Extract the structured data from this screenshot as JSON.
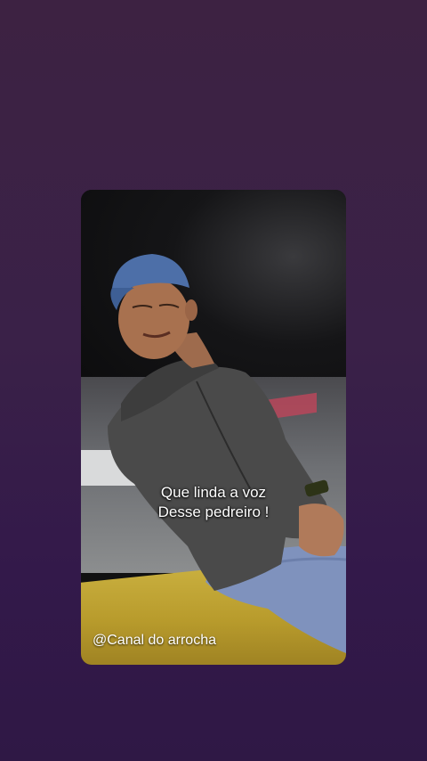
{
  "story": {
    "caption_line1": "Que linda a voz",
    "caption_line2": "Desse pedreiro !",
    "watermark": "@Canal do arrocha"
  },
  "colors": {
    "background_top": "#3d2242",
    "background_bottom": "#2f1845",
    "caption_text": "#ffffff"
  }
}
